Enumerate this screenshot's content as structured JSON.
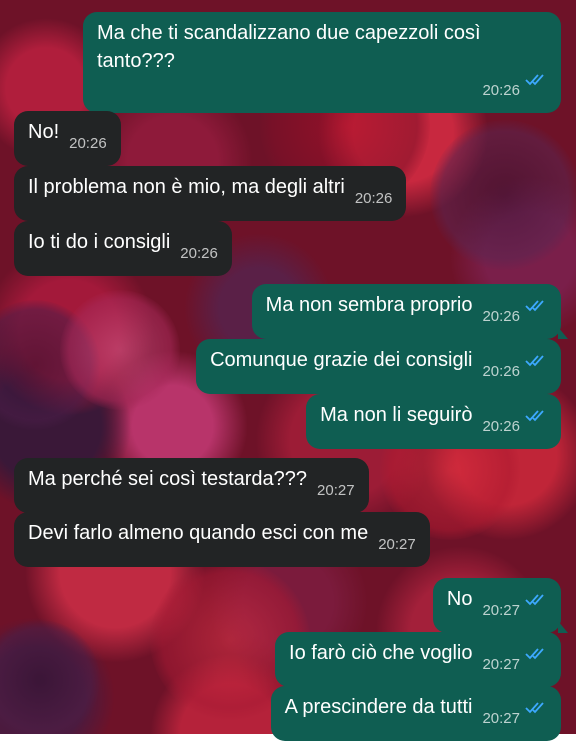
{
  "colors": {
    "incoming_bubble": "#222425",
    "outgoing_bubble": "#0f5e52",
    "read_ticks": "#3da9ff",
    "wallpaper": "#6e1228"
  },
  "messages": [
    {
      "dir": "out",
      "text": "Ma che ti scandalizzano due capezzoli così tanto???",
      "time": "20:26",
      "status": "read"
    },
    {
      "dir": "in",
      "text": "No!",
      "time": "20:26"
    },
    {
      "dir": "in",
      "text": "Il problema non è mio, ma degli altri",
      "time": "20:26"
    },
    {
      "dir": "in",
      "text": "Io ti do i consigli",
      "time": "20:26"
    },
    {
      "dir": "out",
      "text": "Ma non sembra proprio",
      "time": "20:26",
      "status": "read"
    },
    {
      "dir": "out",
      "text": "Comunque grazie dei consigli",
      "time": "20:26",
      "status": "read"
    },
    {
      "dir": "out",
      "text": "Ma non li seguirò",
      "time": "20:26",
      "status": "read"
    },
    {
      "dir": "in",
      "text": "Ma perché sei così testarda???",
      "time": "20:27"
    },
    {
      "dir": "in",
      "text": "Devi farlo almeno quando esci con me",
      "time": "20:27"
    },
    {
      "dir": "out",
      "text": "No",
      "time": "20:27",
      "status": "read"
    },
    {
      "dir": "out",
      "text": "Io farò ciò che voglio",
      "time": "20:27",
      "status": "read"
    },
    {
      "dir": "out",
      "text": "A prescindere da tutti",
      "time": "20:27",
      "status": "read"
    }
  ],
  "icons": {
    "read_receipt": "double-check-icon"
  }
}
